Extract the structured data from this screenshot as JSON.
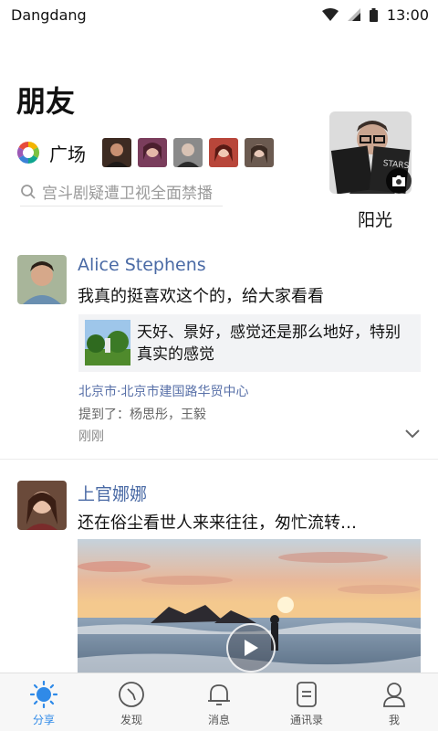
{
  "status_bar": {
    "carrier": "Dangdang",
    "time": "13:00"
  },
  "header": {
    "title": "朋友"
  },
  "square": {
    "label": "广场"
  },
  "search": {
    "placeholder": "宫斗剧疑遭卫视全面禁播"
  },
  "profile": {
    "name": "阳光"
  },
  "posts": [
    {
      "author": "Alice Stephens",
      "text": "我真的挺喜欢这个的，给大家看看",
      "link": {
        "text": "天好、景好，感觉还是那么地好，特别真实的感觉"
      },
      "location": "北京市·北京市建国路华贸中心",
      "mention": "提到了：杨思彤，王毅",
      "time": "刚刚"
    },
    {
      "author": "上官娜娜",
      "text": "还在俗尘看世人来来往往，匆忙流转…"
    }
  ],
  "tabs": [
    {
      "label": "分享",
      "icon": "sun-icon",
      "active": true
    },
    {
      "label": "发现",
      "icon": "compass-icon",
      "active": false
    },
    {
      "label": "消息",
      "icon": "bell-icon",
      "active": false
    },
    {
      "label": "通讯录",
      "icon": "contacts-icon",
      "active": false
    },
    {
      "label": "我",
      "icon": "person-icon",
      "active": false
    }
  ],
  "colors": {
    "accent": "#2f8ae8",
    "name_link": "#4a6aa5",
    "location": "#5870a8"
  }
}
